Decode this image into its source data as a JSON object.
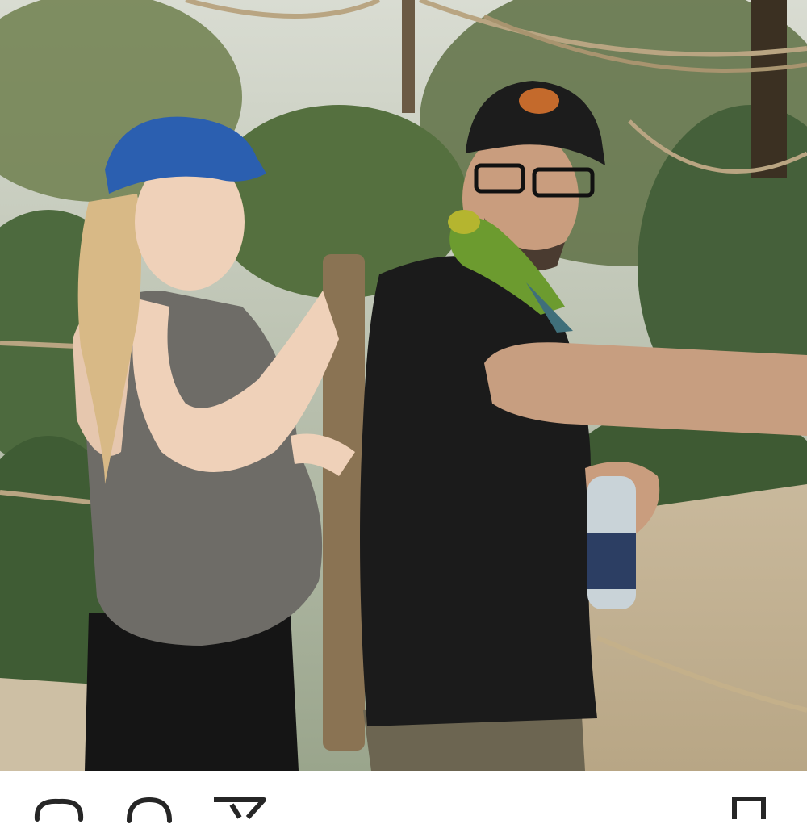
{
  "post": {
    "photo_icon": "photo",
    "scene": "couple-with-parrot-in-aviary"
  },
  "actions": {
    "like_icon": "heart-icon",
    "comment_icon": "comment-icon",
    "share_icon": "send-icon",
    "save_icon": "bookmark-icon"
  },
  "colors": {
    "background": "#ffffff",
    "icon": "#262626"
  }
}
